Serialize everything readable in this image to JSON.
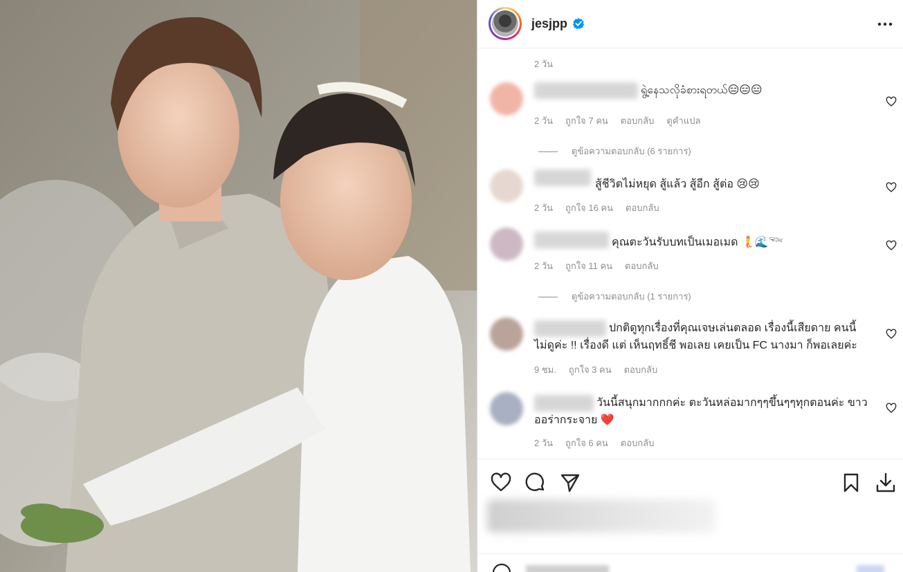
{
  "photo": {
    "alt": ""
  },
  "header": {
    "username": "jesjpp",
    "verified_icon": "verified-badge-icon",
    "more_icon": "more-dots-icon"
  },
  "post_time": "2 วัน",
  "comments": [
    {
      "text": "ရွဲ့နေသလိုခံစားရတယ်😑😑😑",
      "time": "2 วัน",
      "likes": "ถูกใจ 7 คน",
      "reply": "ตอบกลับ",
      "translate": "ดูคำแปล",
      "replies_label": "ดูข้อความตอบกลับ (6 รายการ)"
    },
    {
      "text": "สู้ชีวิตไม่หยุด สู้แล้ว สู้อีก สู้ต่อ 😢😢",
      "time": "2 วัน",
      "likes": "ถูกใจ 16 คน",
      "reply": "ตอบกลับ"
    },
    {
      "text": "คุณตะวันรับบทเป็นเมอเมด 🧜🌊𓆝",
      "time": "2 วัน",
      "likes": "ถูกใจ 11 คน",
      "reply": "ตอบกลับ",
      "replies_label": "ดูข้อความตอบกลับ (1 รายการ)"
    },
    {
      "text_line1": "ปกติดูทุกเรื่องที่คุณเจษเล่นตลอด เรื่องนี้เสียดาย คนนี้",
      "text_line2": "ไม่ดูค่ะ !! เรื่องดี แต่ เห็นฤทธิ์ชี พอเลย เคยเป็น FC นางมา ก็พอเลยค่ะ",
      "time": "9 ชม.",
      "likes": "ถูกใจ 3 คน",
      "reply": "ตอบกลับ"
    },
    {
      "text_line1": "วันนี้สนุกมากกกค่ะ ตะวันหล่อมากๆๆขึ้นๆๆทุกตอนค่ะ ขาว",
      "text_line2": "ออร่ากระจาย ❤️",
      "time": "2 วัน",
      "likes": "ถูกใจ 6 คน",
      "reply": "ตอบกลับ"
    }
  ],
  "actions": {
    "like_icon": "heart-icon",
    "comment_icon": "comment-bubble-icon",
    "share_icon": "share-send-icon",
    "save_icon": "bookmark-icon",
    "download_icon": "download-icon"
  },
  "colors": {
    "text": "#262626",
    "secondary": "#8e8e8e",
    "verified": "#0095f6",
    "divider": "#dbdbdb"
  }
}
